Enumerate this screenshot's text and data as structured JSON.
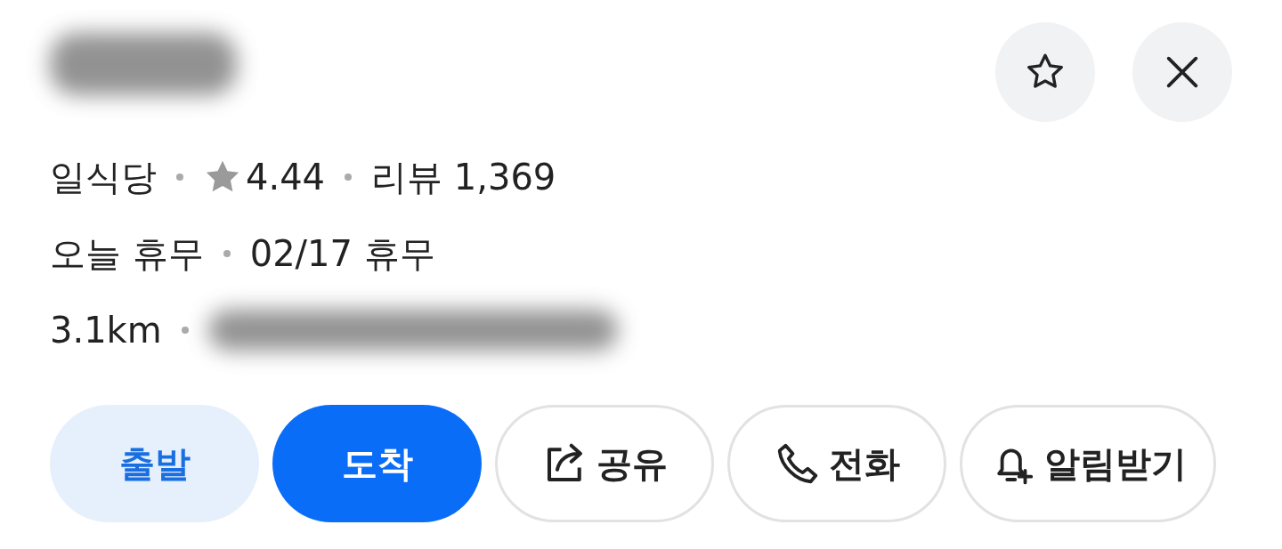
{
  "info_rows": [
    {
      "items": [
        {
          "kind": "text",
          "text": "일식당"
        },
        {
          "kind": "rating",
          "text": "4.44"
        },
        {
          "kind": "text",
          "text": "리뷰 1,369"
        }
      ]
    },
    {
      "items": [
        {
          "kind": "text",
          "text": "오늘 휴무"
        },
        {
          "kind": "text",
          "text": "02/17 휴무"
        }
      ]
    },
    {
      "items": [
        {
          "kind": "text",
          "text": "3.1km"
        },
        {
          "kind": "redacted"
        }
      ]
    }
  ],
  "buttons": [
    {
      "label": "출발",
      "kind": "light"
    },
    {
      "label": "도착",
      "kind": "primary"
    },
    {
      "label": "공유",
      "kind": "share"
    },
    {
      "label": "전화",
      "kind": "phone"
    },
    {
      "label": "알림받기",
      "kind": "bell"
    }
  ]
}
